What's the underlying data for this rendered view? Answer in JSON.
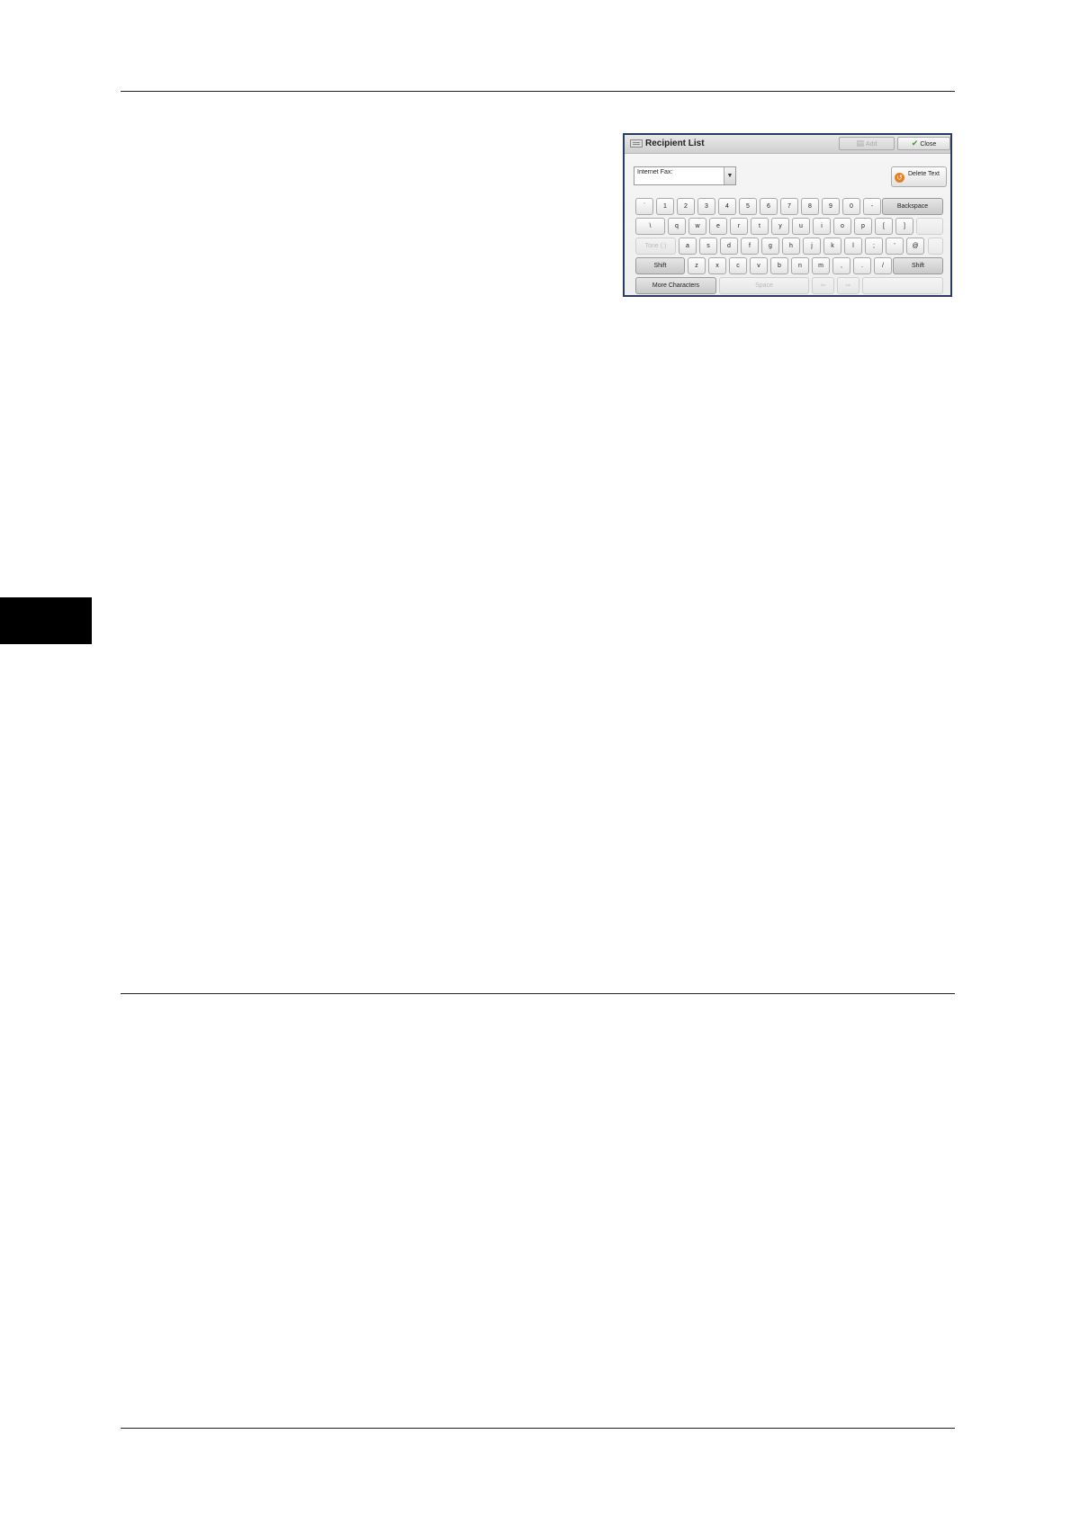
{
  "panel": {
    "title": "Recipient List",
    "add_label": "Add",
    "close_label": "Close",
    "address_type": "Internet Fax:",
    "delete_text_label": "Delete Text",
    "icons": {
      "title": "keyboard-icon",
      "add": "address-book-icon",
      "close": "checkmark-icon",
      "delete": "undo-icon",
      "dropdown": "chevron-down-icon",
      "left": "arrow-left-icon",
      "right": "arrow-right-icon"
    }
  },
  "keyboard": {
    "row1": [
      "`",
      "1",
      "2",
      "3",
      "4",
      "5",
      "6",
      "7",
      "8",
      "9",
      "0",
      "-"
    ],
    "backspace": "Backspace",
    "row2": [
      "\\",
      "q",
      "w",
      "e",
      "r",
      "t",
      "y",
      "u",
      "i",
      "o",
      "p",
      "[",
      "]"
    ],
    "tone": "Tone (:)",
    "row3": [
      "a",
      "s",
      "d",
      "f",
      "g",
      "h",
      "j",
      "k",
      "l",
      ";",
      "'",
      "@"
    ],
    "shift": "Shift",
    "row4": [
      "z",
      "x",
      "c",
      "v",
      "b",
      "n",
      "m",
      ",",
      ".",
      "/"
    ],
    "more": "More Characters",
    "space": "Space"
  }
}
